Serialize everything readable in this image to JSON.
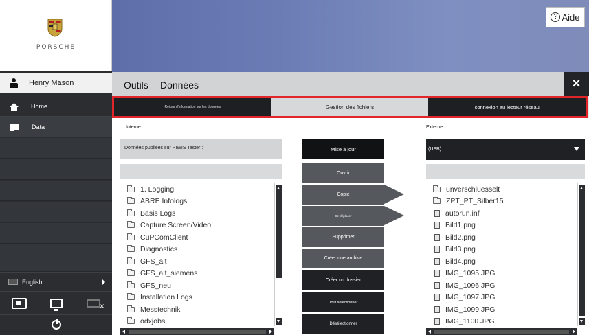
{
  "header": {
    "help_label": "Aide",
    "help_icon": "question-circle-icon"
  },
  "branding": {
    "wordmark": "PORSCHE",
    "crest_colors": [
      "#c8a23a",
      "#b21d22",
      "#222222"
    ]
  },
  "user": {
    "name": "Henry Mason"
  },
  "sidebar": {
    "items": [
      {
        "label": "Home",
        "icon": "home-icon"
      },
      {
        "label": "Data",
        "icon": "data-folder-icon"
      }
    ],
    "language": "English",
    "tools": [
      "battery-icon",
      "monitor-icon",
      "disconnect-icon"
    ],
    "power_icon": "power-icon"
  },
  "menu": {
    "items": [
      "Outils",
      "Données"
    ],
    "close_label": "×"
  },
  "tabs": [
    {
      "label": "Retour d'information sur les données",
      "active": false
    },
    {
      "label": "Gestion des fichiers",
      "active": true
    },
    {
      "label": "connexion au lecteur réseau",
      "active": false
    }
  ],
  "panels": {
    "left": {
      "label": "Interne",
      "source": "Données publiées sur PIWIS Tester :",
      "items": [
        {
          "name": "1. Logging",
          "type": "folder"
        },
        {
          "name": "ABRE Infologs",
          "type": "folder"
        },
        {
          "name": "Basis Logs",
          "type": "folder"
        },
        {
          "name": "Capture Screen/Video",
          "type": "folder"
        },
        {
          "name": "CuPComClient",
          "type": "folder"
        },
        {
          "name": "Diagnostics",
          "type": "folder"
        },
        {
          "name": "GFS_alt",
          "type": "folder"
        },
        {
          "name": "GFS_alt_siemens",
          "type": "folder"
        },
        {
          "name": "GFS_neu",
          "type": "folder"
        },
        {
          "name": "Installation Logs",
          "type": "folder"
        },
        {
          "name": "Messtechnik",
          "type": "folder"
        },
        {
          "name": "odxjobs",
          "type": "folder"
        }
      ]
    },
    "right": {
      "label": "Externe",
      "device": "(USB)",
      "items": [
        {
          "name": "unverschluesselt",
          "type": "folder"
        },
        {
          "name": "ZPT_PT_Silber15",
          "type": "folder"
        },
        {
          "name": "autorun.inf",
          "type": "file"
        },
        {
          "name": "Bild1.png",
          "type": "file"
        },
        {
          "name": "Bild2.png",
          "type": "file"
        },
        {
          "name": "Bild3.png",
          "type": "file"
        },
        {
          "name": "Bild4.png",
          "type": "file"
        },
        {
          "name": "IMG_1095.JPG",
          "type": "file"
        },
        {
          "name": "IMG_1096.JPG",
          "type": "file"
        },
        {
          "name": "IMG_1097.JPG",
          "type": "file"
        },
        {
          "name": "IMG_1099.JPG",
          "type": "file"
        },
        {
          "name": "IMG_1100.JPG",
          "type": "file"
        }
      ]
    }
  },
  "actions": {
    "mise_a_jour": "Mise à jour",
    "ouvrir": "Ouvrir",
    "copie": "Copie",
    "deplacer": "Se déplacer",
    "supprimer": "Supprimer",
    "archive": "Créer une archive",
    "dossier": "Créer un dossier",
    "tout": "Tout sélectionner",
    "deselect": "Désélectionner"
  },
  "colors": {
    "accent_red": "#e2252a",
    "banner_blue": "#6b7cb5",
    "sidebar_dark": "#2b2d30"
  }
}
